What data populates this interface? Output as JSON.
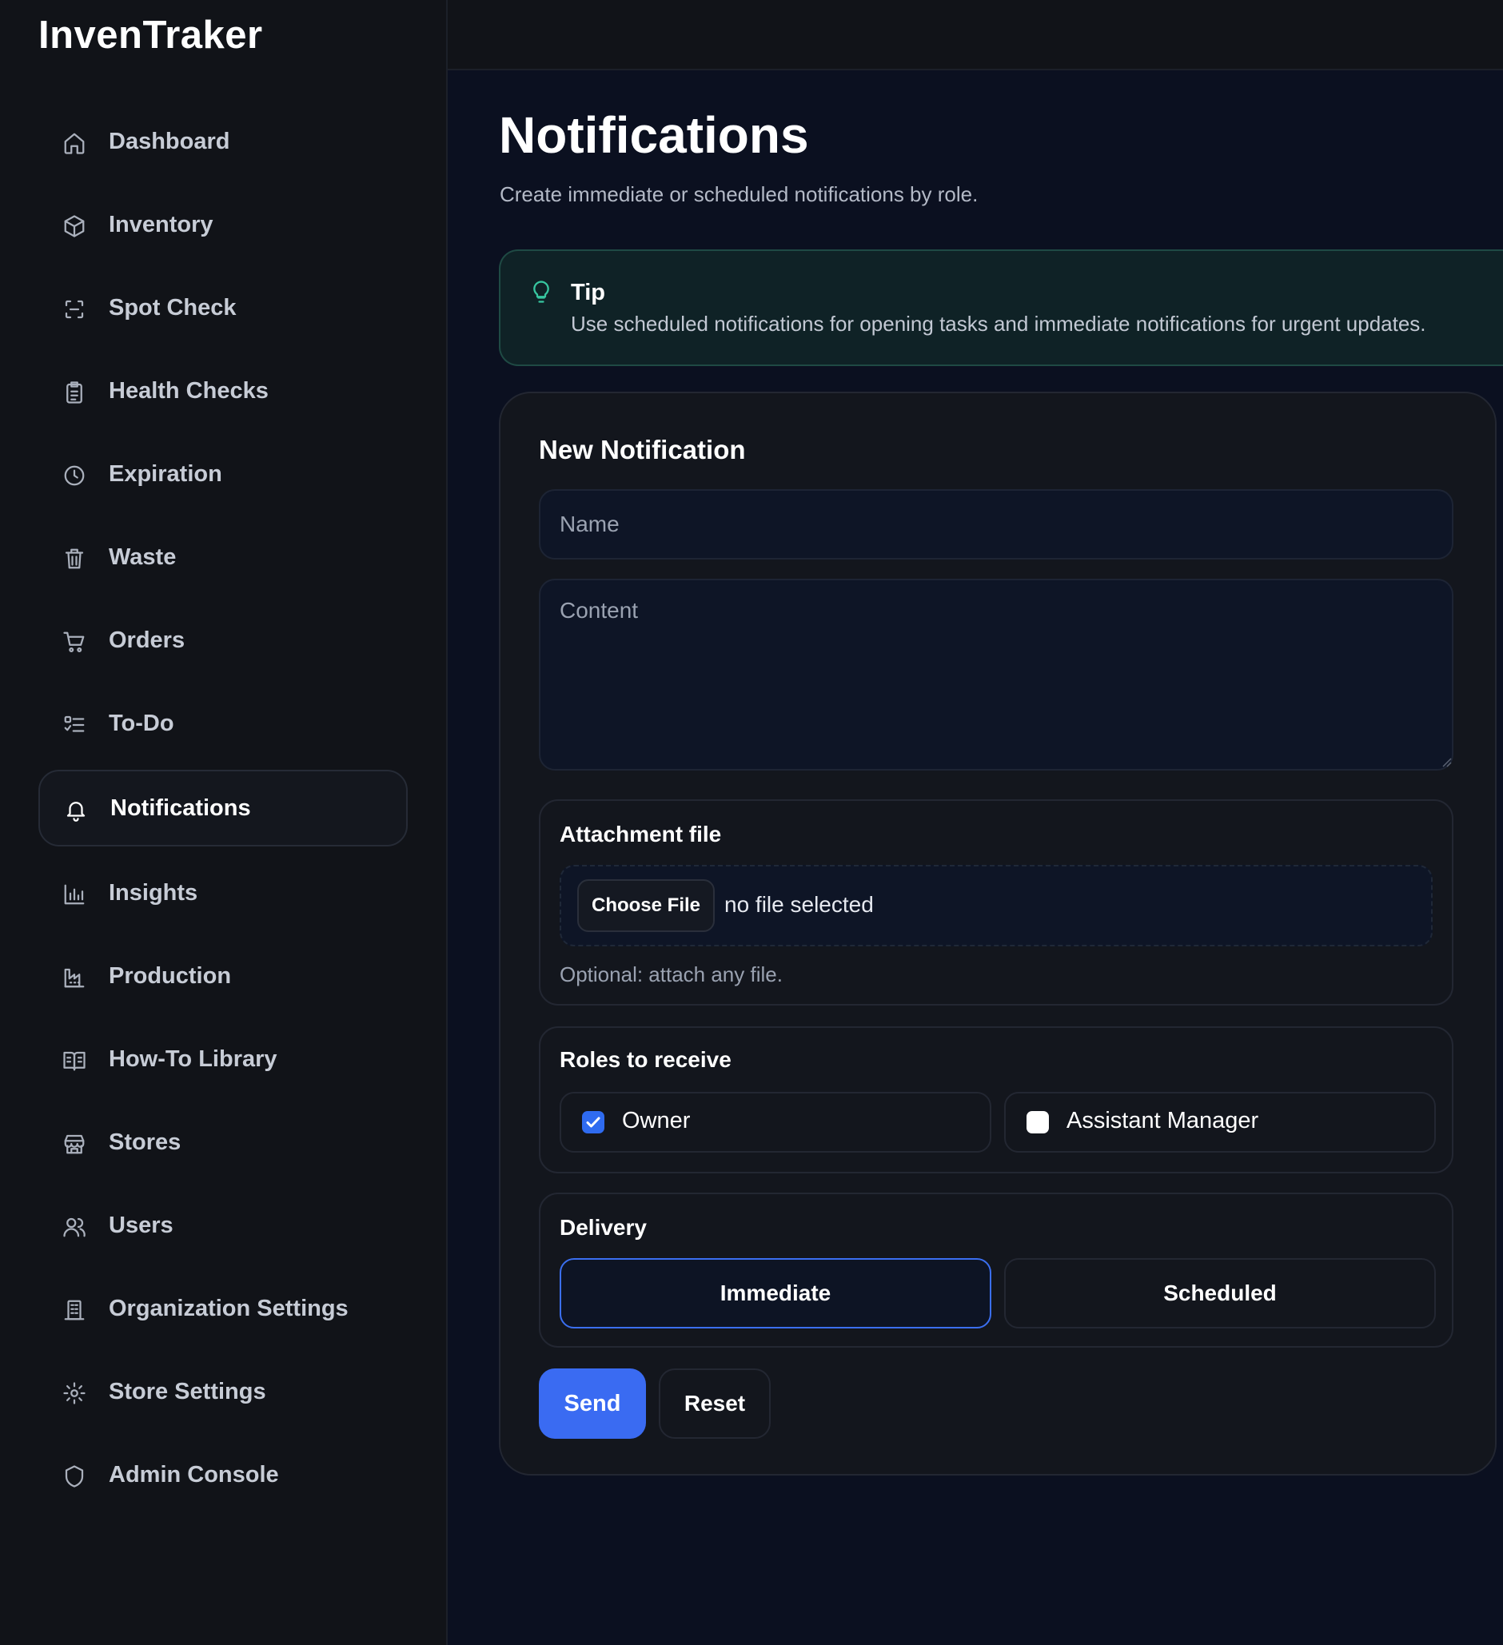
{
  "app": {
    "brand": "InvenTraker"
  },
  "sidebar": {
    "items": [
      {
        "label": "Dashboard",
        "icon": "home-icon",
        "active": false
      },
      {
        "label": "Inventory",
        "icon": "box-icon",
        "active": false
      },
      {
        "label": "Spot Check",
        "icon": "scan-icon",
        "active": false
      },
      {
        "label": "Health Checks",
        "icon": "clipboard-icon",
        "active": false
      },
      {
        "label": "Expiration",
        "icon": "clock-icon",
        "active": false
      },
      {
        "label": "Waste",
        "icon": "trash-icon",
        "active": false
      },
      {
        "label": "Orders",
        "icon": "cart-icon",
        "active": false
      },
      {
        "label": "To-Do",
        "icon": "checklist-icon",
        "active": false
      },
      {
        "label": "Notifications",
        "icon": "bell-icon",
        "active": true
      },
      {
        "label": "Insights",
        "icon": "bar-chart-icon",
        "active": false
      },
      {
        "label": "Production",
        "icon": "factory-icon",
        "active": false
      },
      {
        "label": "How-To Library",
        "icon": "book-icon",
        "active": false
      },
      {
        "label": "Stores",
        "icon": "store-icon",
        "active": false
      },
      {
        "label": "Users",
        "icon": "users-icon",
        "active": false
      },
      {
        "label": "Organization Settings",
        "icon": "building-icon",
        "active": false
      },
      {
        "label": "Store Settings",
        "icon": "gear-icon",
        "active": false
      },
      {
        "label": "Admin Console",
        "icon": "shield-icon",
        "active": false
      }
    ]
  },
  "page": {
    "title": "Notifications",
    "subtitle": "Create immediate or scheduled notifications by role."
  },
  "tip": {
    "title": "Tip",
    "text": "Use scheduled notifications for opening tasks and immediate notifications for urgent updates.",
    "icon": "lightbulb-icon"
  },
  "form": {
    "title": "New Notification",
    "name_placeholder": "Name",
    "name_value": "",
    "content_placeholder": "Content",
    "content_value": "",
    "attachment": {
      "title": "Attachment file",
      "button_label": "Choose File",
      "status": "no file selected",
      "hint": "Optional: attach any file."
    },
    "roles": {
      "title": "Roles to receive",
      "options": [
        {
          "label": "Owner",
          "checked": true
        },
        {
          "label": "Assistant Manager",
          "checked": false
        }
      ]
    },
    "delivery": {
      "title": "Delivery",
      "options": [
        "Immediate",
        "Scheduled"
      ],
      "selected": "Immediate"
    },
    "send_label": "Send",
    "reset_label": "Reset"
  },
  "colors": {
    "accent": "#3a6bf2",
    "tip_accent": "#37c6a0",
    "background": "#0b1020",
    "sidebar": "#111318"
  }
}
